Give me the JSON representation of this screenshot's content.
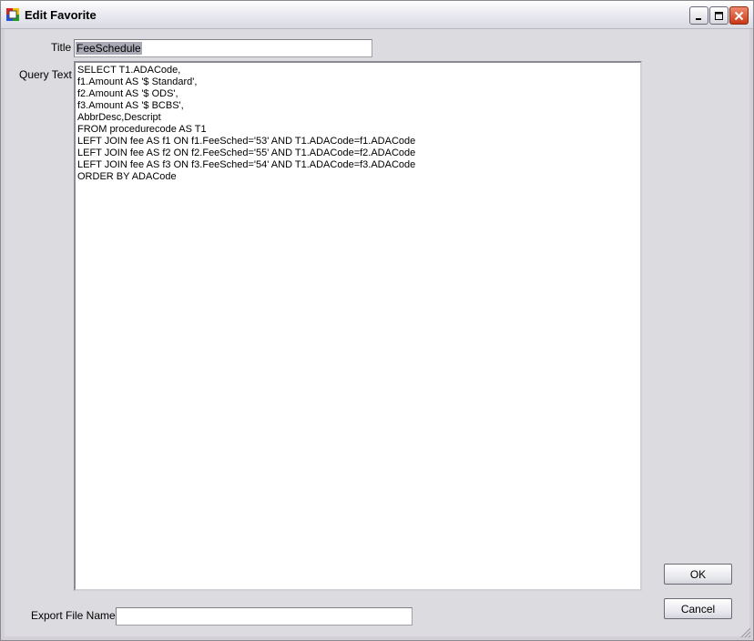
{
  "window": {
    "title": "Edit Favorite"
  },
  "form": {
    "title_label": "Title",
    "title_value": "FeeSchedule",
    "query_label": "Query Text",
    "query_lines": [
      "SELECT T1.ADACode,",
      "f1.Amount AS '$ Standard',",
      "f2.Amount AS '$ ODS',",
      "f3.Amount AS '$ BCBS',",
      "AbbrDesc,Descript",
      "FROM procedurecode AS T1",
      "LEFT JOIN fee AS f1 ON f1.FeeSched='53' AND T1.ADACode=f1.ADACode",
      "LEFT JOIN fee AS f2 ON f2.FeeSched='55' AND T1.ADACode=f2.ADACode",
      "LEFT JOIN fee AS f3 ON f3.FeeSched='54' AND T1.ADACode=f3.ADACode",
      "ORDER BY ADACode"
    ],
    "export_label": "Export File Name",
    "export_value": ""
  },
  "buttons": {
    "ok": "OK",
    "cancel": "Cancel"
  },
  "colors": {
    "titlebar": "#e6e6ee",
    "client_bg": "#dcdbe0",
    "selection": "#a9a9b6",
    "close_button": "#d84a28"
  },
  "icons": [
    "app-icon",
    "minimize-icon",
    "maximize-icon",
    "close-icon",
    "resize-grip-icon"
  ]
}
